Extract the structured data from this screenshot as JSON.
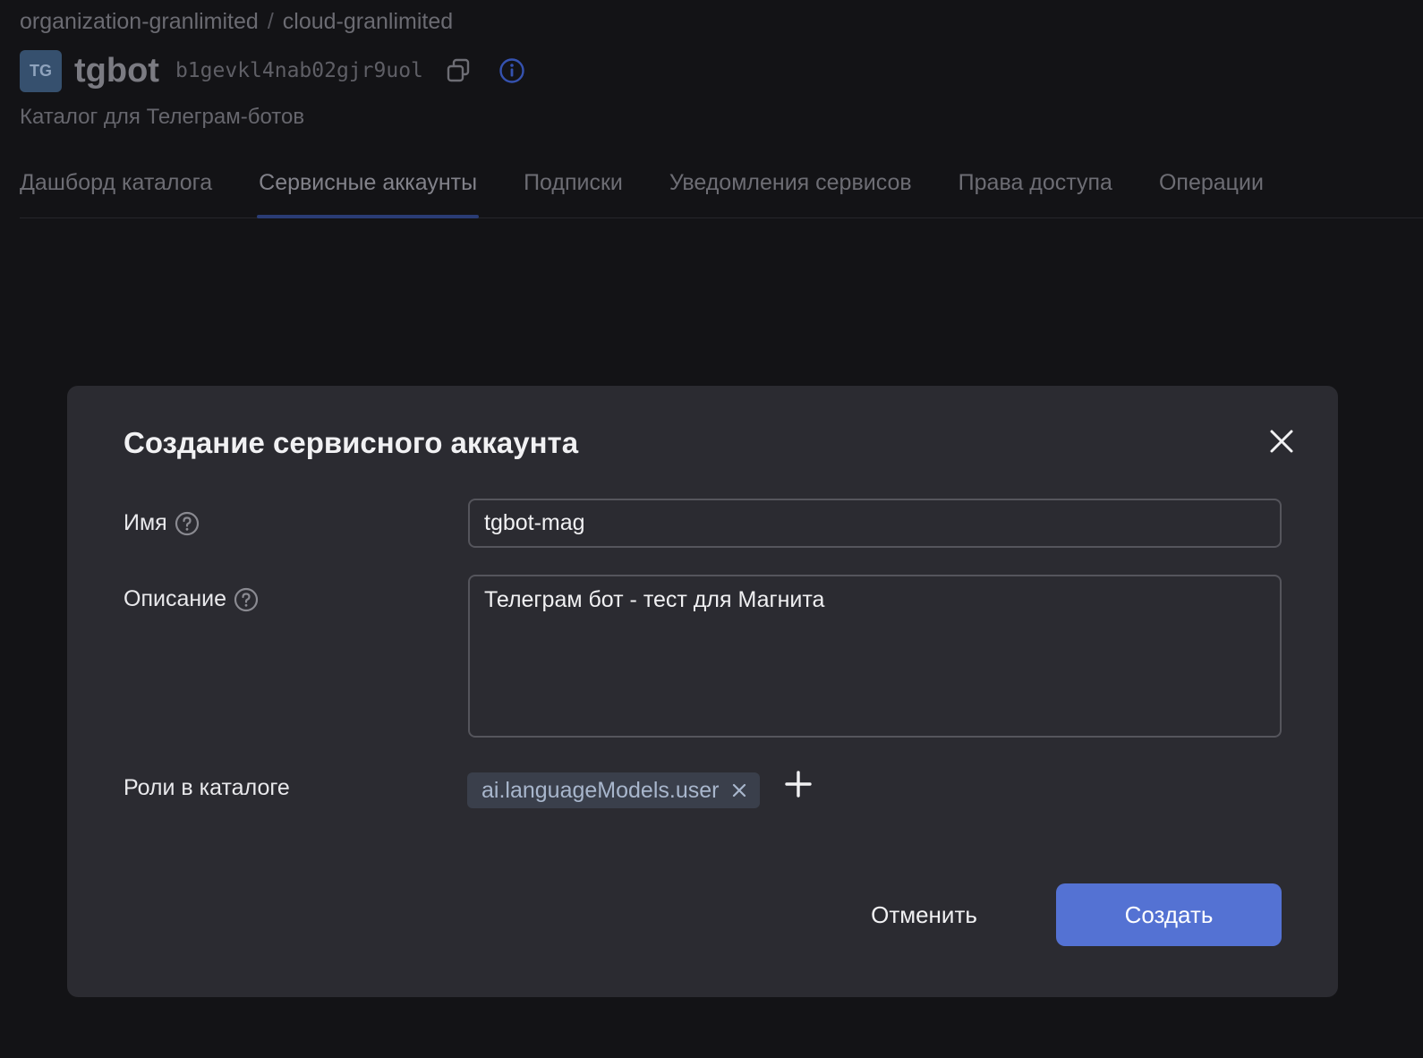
{
  "breadcrumb": {
    "organization": "organization-granlimited",
    "separator": "/",
    "cloud": "cloud-granlimited"
  },
  "folder": {
    "avatar_text": "TG",
    "name": "tgbot",
    "id": "b1gevkl4nab02gjr9uol",
    "description": "Каталог для Телеграм-ботов"
  },
  "tabs": [
    {
      "label": "Дашборд каталога",
      "active": false
    },
    {
      "label": "Сервисные аккаунты",
      "active": true
    },
    {
      "label": "Подписки",
      "active": false
    },
    {
      "label": "Уведомления сервисов",
      "active": false
    },
    {
      "label": "Права доступа",
      "active": false
    },
    {
      "label": "Операции",
      "active": false
    }
  ],
  "modal": {
    "title": "Создание сервисного аккаунта",
    "name_label": "Имя",
    "name_value": "tgbot-mag",
    "description_label": "Описание",
    "description_value": "Телеграм бот - тест для Магнита",
    "roles_label": "Роли в каталоге",
    "roles": [
      "ai.languageModels.user"
    ],
    "cancel_label": "Отменить",
    "create_label": "Создать"
  },
  "colors": {
    "accent": "#5472d3",
    "modal_bg": "#2b2b31",
    "page_bg": "#131316",
    "chip_bg": "#3a3f4b"
  },
  "icons": {
    "copy": "copy-icon",
    "info": "info-icon",
    "help": "help-icon",
    "close": "close-icon",
    "remove": "remove-icon",
    "add": "plus-icon"
  }
}
